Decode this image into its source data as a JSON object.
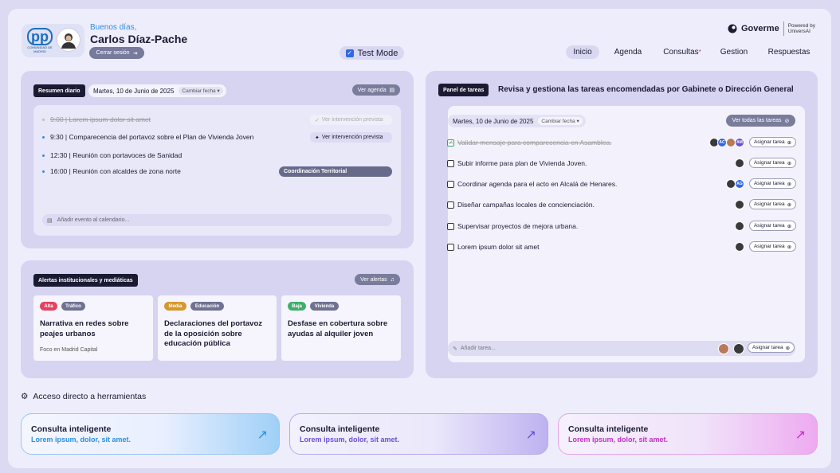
{
  "header": {
    "logo_text": "pp",
    "logo_subtext": "COMUNIDAD DE MADRID",
    "greeting": "Buenos días,",
    "user_name": "Carlos Díaz-Pache",
    "logout_label": "Cerrar sesión",
    "test_mode_label": "Test Mode",
    "brand_name": "Goverme",
    "powered_by": "Powered by",
    "powered_company": "UniversAI"
  },
  "nav": {
    "items": [
      {
        "label": "Inicio",
        "active": true
      },
      {
        "label": "Agenda",
        "active": false
      },
      {
        "label": "Consultas",
        "active": false,
        "badge": "*"
      },
      {
        "label": "Gestion",
        "active": false
      },
      {
        "label": "Respuestas",
        "active": false
      }
    ]
  },
  "resumen": {
    "title": "Resumen diario",
    "date": "Martes, 10 de Junio de 2025",
    "change_date": "Cambiar fecha",
    "view_agenda": "Ver agenda",
    "events": [
      {
        "text": "9:00 | Lorem ipsum dolor sit amet",
        "done": true,
        "action": "Ver intervención prevista"
      },
      {
        "text": "9:30 | Comparecencia del portavoz sobre el Plan de Vivienda Joven",
        "done": false,
        "action": "Ver intervención prevista"
      },
      {
        "text": "12:30 | Reunión con portavoces de Sanidad",
        "done": false
      },
      {
        "text": "16:00 | Reunión con alcaldes de zona norte",
        "done": false,
        "tag": "Coordinación Territorial"
      }
    ],
    "add_event": "Añadir evento al calendario..."
  },
  "alertas": {
    "title": "Alertas institucionales y mediáticas",
    "view_alerts": "Ver alertas",
    "cards": [
      {
        "priority": "Alta",
        "priority_color": "#e2435f",
        "category": "Tráfico",
        "title": "Narrativa en redes sobre peajes urbanos",
        "subtitle": "Foco en Madrid Capital"
      },
      {
        "priority": "Media",
        "priority_color": "#d6982c",
        "category": "Educación",
        "title": "Declaraciones del portavoz de la oposición sobre educación pública",
        "subtitle": ""
      },
      {
        "priority": "Baja",
        "priority_color": "#3fae6a",
        "category": "Vivienda",
        "title": "Desfase en cobertura sobre ayudas al alquiler joven",
        "subtitle": ""
      }
    ]
  },
  "tareas": {
    "title": "Panel de tareas",
    "description": "Revisa y gestiona las tareas encomendadas por Gabinete o Dirección General",
    "date": "Martes, 10 de Junio de 2025",
    "change_date": "Cambiar fecha",
    "view_all": "Ver todas las tareas",
    "assign_label": "Asignar tarea",
    "items": [
      {
        "text": "Validar mensaje para comparecencia en Asamblea.",
        "done": true,
        "avatars": [
          "",
          "AC",
          "",
          "AM"
        ]
      },
      {
        "text": "Subir informe para plan de Vivienda Joven.",
        "done": false,
        "avatars": [
          ""
        ]
      },
      {
        "text": "Coordinar agenda para el acto en Alcalá de Henares.",
        "done": false,
        "avatars": [
          "",
          "AG"
        ]
      },
      {
        "text": "Diseñar campañas locales de concienciación.",
        "done": false,
        "avatars": [
          ""
        ]
      },
      {
        "text": "Supervisar proyectos de mejora urbana.",
        "done": false,
        "avatars": [
          ""
        ]
      },
      {
        "text": "Lorem ipsum dolor sit amet",
        "done": false,
        "avatars": [
          ""
        ]
      }
    ],
    "add_task": "Añadir tarea..."
  },
  "herramientas": {
    "title": "Acceso directo a herramientas",
    "cards": [
      {
        "title": "Consulta inteligente",
        "subtitle": "Lorem ipsum, dolor, sit amet.",
        "accent": "#2a8ee4"
      },
      {
        "title": "Consulta inteligente",
        "subtitle": "Lorem ipsum, dolor, sit amet.",
        "accent": "#6a4fd6"
      },
      {
        "title": "Consulta inteligente",
        "subtitle": "Lorem ipsum, dolor, sit amet.",
        "accent": "#c42ec9"
      }
    ]
  },
  "icons": [
    "logout-icon",
    "calendar-icon",
    "bell-icon",
    "arrow-up-right-icon",
    "gear-icon",
    "check-icon",
    "plus-icon"
  ]
}
